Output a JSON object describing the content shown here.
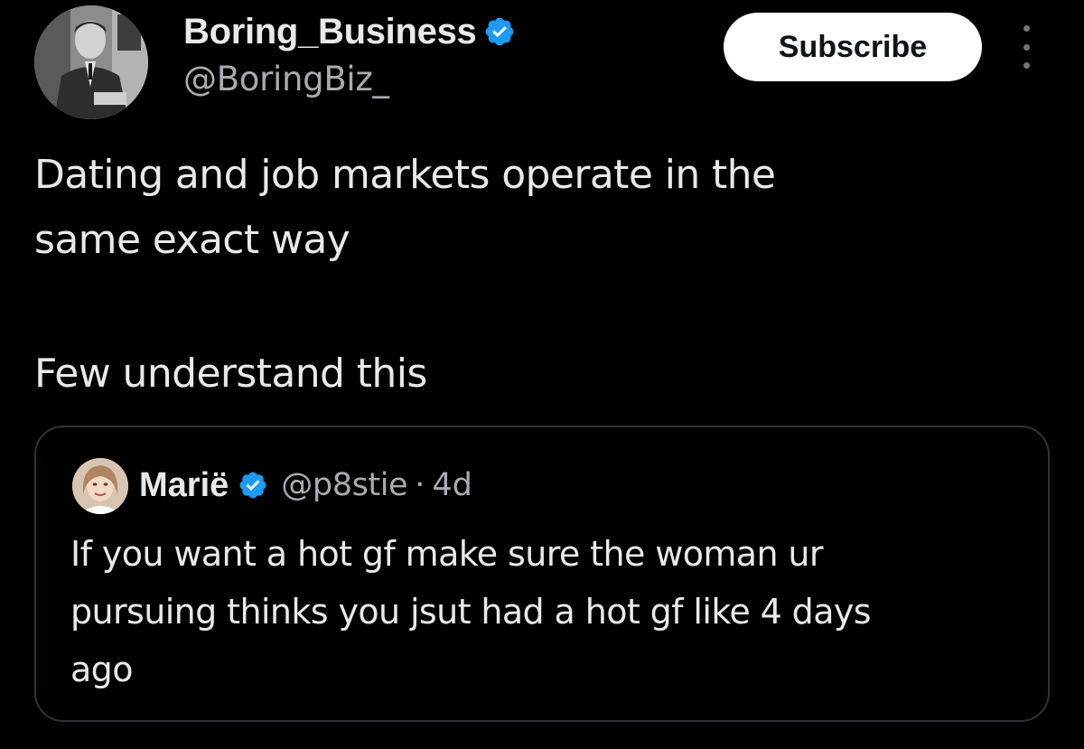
{
  "tweet": {
    "author": {
      "display_name": "Boring_Business",
      "handle": "@BoringBiz_",
      "verified": true,
      "avatar_icon": "profile-photo"
    },
    "subscribe_label": "Subscribe",
    "more_icon": "more-vertical-icon",
    "text_lines": [
      "Dating and job markets operate in the",
      "same exact way"
    ],
    "text_line_3": "Few understand this"
  },
  "quoted_tweet": {
    "author": {
      "display_name": "Marië",
      "handle": "@p8stie",
      "verified": true,
      "avatar_icon": "profile-photo"
    },
    "separator": "·",
    "age": "4d",
    "text_lines": [
      "If you want a hot gf make sure the woman ur",
      "pursuing thinks you jsut had a hot gf like 4 days",
      "ago"
    ]
  },
  "colors": {
    "background": "#000000",
    "text_primary": "#e7e9ea",
    "text_secondary": "#a8acb1",
    "verified_blue": "#1d9bf0",
    "card_border": "#2f3336"
  }
}
